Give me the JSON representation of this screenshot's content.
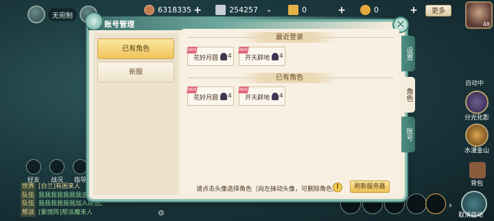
{
  "hud": {
    "server_label": "无宛制",
    "copper": "6318335",
    "silver": "254257",
    "gold": "0",
    "ingot": "0",
    "more": "更多",
    "level": "48",
    "colors": {
      "copper": "#c77b53",
      "silver": "#c9ced8",
      "gold": "#e3b34a",
      "ingot": "#e8a93b"
    }
  },
  "chat": {
    "side_icons": [
      "好友",
      "战况",
      "指导"
    ],
    "messages": [
      {
        "channel": "世界",
        "text": "[白兰]有困来人"
      },
      {
        "channel": "队伍",
        "text": "我我我我我我我追到"
      },
      {
        "channel": "队伍",
        "text": "我我我我我我加入队伍。"
      },
      {
        "channel": "帮派",
        "text": "[紫情阵]帮派魔来人"
      }
    ]
  },
  "right": {
    "auto": "自动中",
    "skill1": "分光化影",
    "skill2": "水漫金山",
    "bag": "背包",
    "quit": "取消自动"
  },
  "dialog": {
    "title": "账号管理",
    "close_icon": "✕",
    "left_buttons": [
      "已有角色",
      "新服"
    ],
    "sections": [
      {
        "title": "最近登录",
        "characters": [
          {
            "name": "花好月圆",
            "count": "4"
          },
          {
            "name": "开天辟地",
            "count": "4"
          }
        ]
      },
      {
        "title": "已有角色",
        "characters": [
          {
            "name": "花好月圆",
            "count": "4"
          },
          {
            "name": "开天辟地",
            "count": "4"
          }
        ]
      }
    ],
    "hint": "请点击头像选择角色（向左抹动头像，可删除角色）",
    "hint_icon": "!",
    "refresh": "刷新服务器",
    "tabs": [
      "设置",
      "角色",
      "账号"
    ],
    "badge": "NEW"
  }
}
